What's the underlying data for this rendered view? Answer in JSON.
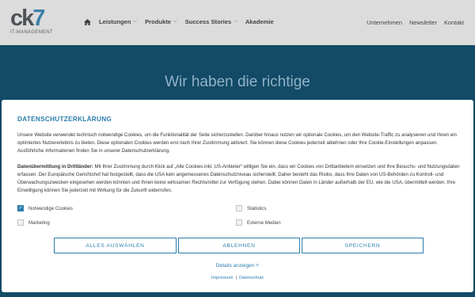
{
  "header": {
    "logo_text": "ck7",
    "logo_sub": "IT-MANAGEMENT",
    "nav": [
      {
        "label": "Leistungen"
      },
      {
        "label": "Produkte"
      },
      {
        "label": "Success Stories"
      },
      {
        "label": "Akademie"
      }
    ],
    "meta_nav": [
      "Unternehmen",
      "Newsletter",
      "Kontakt"
    ]
  },
  "hero": {
    "title": "Wir haben die richtige"
  },
  "cookie_dialog": {
    "title": "DATENSCHUTZERKLÄRUNG",
    "intro": "Unsere Website verwendet technisch notwendige Cookies, um die Funktionalität der Seite sicherzustellen. Darüber hinaus nutzen wir optionale Cookies, um den Website-Traffic zu analysieren und Ihnen ein optimiertes Nutzererlebnis zu bieten. Diese optionalen Cookies werden erst nach Ihrer Zustimmung aktiviert. Sie können diese Cookies jederzeit ablehnen oder Ihre Cookie-Einstellungen anpassen. Ausführliche Informationen finden Sie in unserer Datenschutzerklärung.",
    "transfer_label": "Datenübermittlung in Drittländer:",
    "transfer_text": " Mit Ihrer Zustimmung durch Klick auf „Alle Cookies inkl. US-Anbieter“ willigen Sie ein, dass wir Cookies von Drittanbietern einsetzen und Ihre Besuchs- und Nutzungsdaten erfassen. Der Europäische Gerichtshof hat festgestellt, dass die USA kein angemessenes Datenschutzniveau sicherstellt. Daher besteht das Risiko, dass Ihre Daten von US-Behörden zu Kontroll- und Überwachungszwecken eingesehen werden könnten und Ihnen keine wirksamen Rechtsmittel zur Verfügung stehen. Dabei können Daten in Länder außerhalb der EU, wie die USA, übermittelt werden. Ihre Einwilligung können Sie jederzeit mit Wirkung für die Zukunft widerrufen.",
    "options": [
      {
        "label": "Notwendige Cookies",
        "checked": true
      },
      {
        "label": "Statistics",
        "checked": false
      },
      {
        "label": "Marketing",
        "checked": false
      },
      {
        "label": "Externe Medien",
        "checked": false
      }
    ],
    "buttons": {
      "select_all": "ALLES AUSWÄHLEN",
      "reject": "ABLEHNEN",
      "save": "SPEICHERN"
    },
    "details_link": "Details anzeigen",
    "footer_links": [
      "Impressum",
      "Datenschutz"
    ],
    "accent_color": "#2c7dad"
  }
}
